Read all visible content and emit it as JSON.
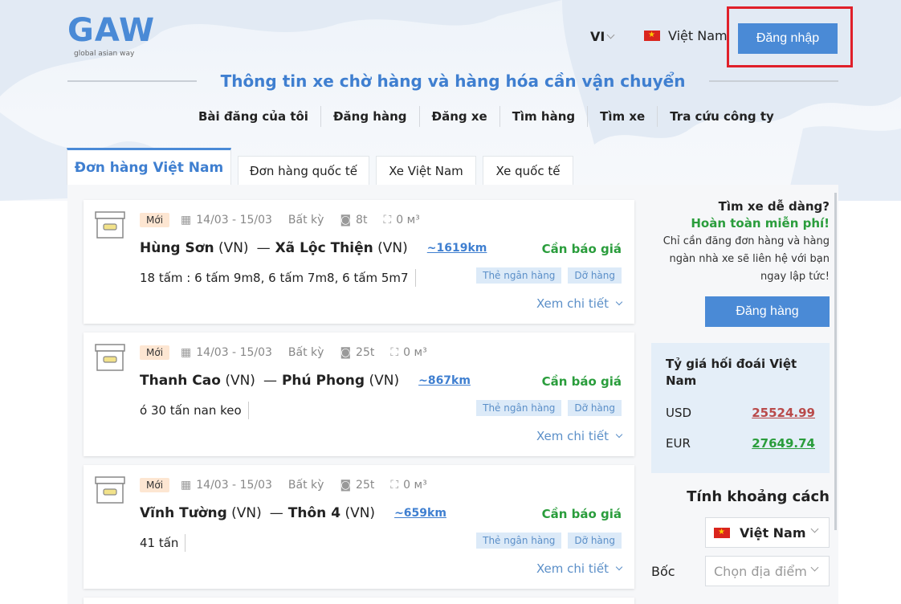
{
  "header": {
    "logo": "GAW",
    "logo_sub": "global asian way",
    "language": "VI",
    "country": "Việt Nam",
    "login_label": "Đăng nhập"
  },
  "page_title": "Thông tin xe chờ hàng và hàng hóa cần vận chuyển",
  "nav": {
    "items": [
      "Bài đăng của tôi",
      "Đăng hàng",
      "Đăng xe",
      "Tìm hàng",
      "Tìm xe",
      "Tra cứu công ty"
    ]
  },
  "tabs": {
    "items": [
      "Đơn hàng Việt Nam",
      "Đơn hàng quốc tế",
      "Xe Việt Nam",
      "Xe quốc tế"
    ],
    "active": 0
  },
  "orders": [
    {
      "badge": "Mới",
      "dates": "14/03 - 15/03",
      "vehicle": "Bất kỳ",
      "weight": "8t",
      "volume": "0 м³",
      "from": "Hùng Sơn",
      "from_code": "(VN)",
      "to": "Xã Lộc Thiện",
      "to_code": "(VN)",
      "distance": "~1619km",
      "price": "Cần báo giá",
      "description": "18 tấm : 6 tấm 9m8, 6 tấm 7m8, 6 tấm 5m7",
      "tags": [
        "Thẻ ngân hàng",
        "Dỡ hàng"
      ],
      "more": "Xem chi tiết"
    },
    {
      "badge": "Mới",
      "dates": "14/03 - 15/03",
      "vehicle": "Bất kỳ",
      "weight": "25t",
      "volume": "0 м³",
      "from": "Thanh Cao",
      "from_code": "(VN)",
      "to": "Phú Phong",
      "to_code": "(VN)",
      "distance": "~867km",
      "price": "Cần báo giá",
      "description": "ó 30 tấn nan keo",
      "tags": [
        "Thẻ ngân hàng",
        "Dỡ hàng"
      ],
      "more": "Xem chi tiết"
    },
    {
      "badge": "Mới",
      "dates": "14/03 - 15/03",
      "vehicle": "Bất kỳ",
      "weight": "25t",
      "volume": "0 м³",
      "from": "Vĩnh Tường",
      "from_code": "(VN)",
      "to": "Thôn 4",
      "to_code": "(VN)",
      "distance": "~659km",
      "price": "Cần báo giá",
      "description": "41 tấn",
      "tags": [
        "Thẻ ngân hàng",
        "Dỡ hàng"
      ],
      "more": "Xem chi tiết"
    }
  ],
  "sidebar": {
    "promo_heading": "Tìm xe dễ dàng?",
    "promo_free": "Hoàn toàn miễn phí!",
    "promo_text": "Chỉ cần đăng đơn hàng và hàng ngàn nhà xe sẽ liên hệ với bạn ngay lập tức!",
    "post_button": "Đăng hàng",
    "fx_title": "Tỷ giá hối đoái Việt Nam",
    "fx_usd_label": "USD",
    "fx_usd_value": "25524.99",
    "fx_eur_label": "EUR",
    "fx_eur_value": "27649.74",
    "distance_title": "Tính khoảng cách",
    "distance_country": "Việt Nam",
    "from_label": "Bốc",
    "place_placeholder": "Chọn địa điểm"
  },
  "colors": {
    "brand": "#4a8ad6",
    "title_blue": "#3f7fd0",
    "price_green": "#2a9d3c",
    "usd_red": "#b94a4a",
    "highlight_red": "#e0202a"
  }
}
